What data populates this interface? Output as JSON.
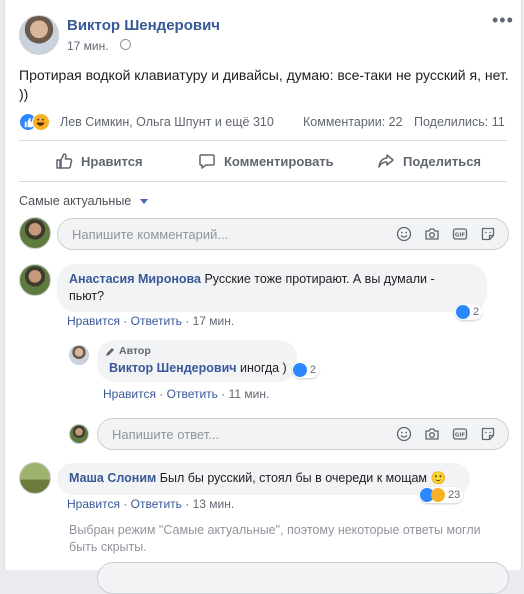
{
  "post": {
    "author": "Виктор Шендерович",
    "time": "17 мин.",
    "text": "Протирая водкой клавиатуру и дивайсы, думаю: все-таки не русский я, нет. ))",
    "reactions_names": "Лев Симкин, Ольга Шпунт и ещё 310",
    "comments_count": "Комментарии: 22",
    "shares_count": "Поделились: 11"
  },
  "actions": {
    "like": "Нравится",
    "comment": "Комментировать",
    "share": "Поделиться"
  },
  "sort_label": "Самые актуальные",
  "comment_input": {
    "placeholder": "Напишите комментарий..."
  },
  "comments": [
    {
      "name": "Анастасия Миронова",
      "text_line1": "Русские тоже протирают. А вы думали -",
      "text_line2": "пьют?",
      "reactions": "2",
      "like": "Нравится",
      "reply": "Ответить",
      "time": "17 мин."
    },
    {
      "badge": "Автор",
      "name": "Виктор Шендерович",
      "text": "иногда )",
      "reactions": "2",
      "like": "Нравится",
      "reply": "Ответить",
      "time": "11 мин."
    },
    {
      "name": "Маша Слоним",
      "text": "Был бы русский, стоял бы в очереди к мощам 🙂",
      "reactions": "23",
      "like": "Нравится",
      "reply": "Ответить",
      "time": "13 мин."
    }
  ],
  "reply_input": {
    "placeholder": "Напишите ответ..."
  },
  "notice": "Выбран режим \"Самые актуальные\", поэтому некоторые ответы могли быть скрыты.",
  "colors": {
    "link": "#385898",
    "like_blue": "#2d88ff",
    "haha_yellow": "#f7b125"
  }
}
